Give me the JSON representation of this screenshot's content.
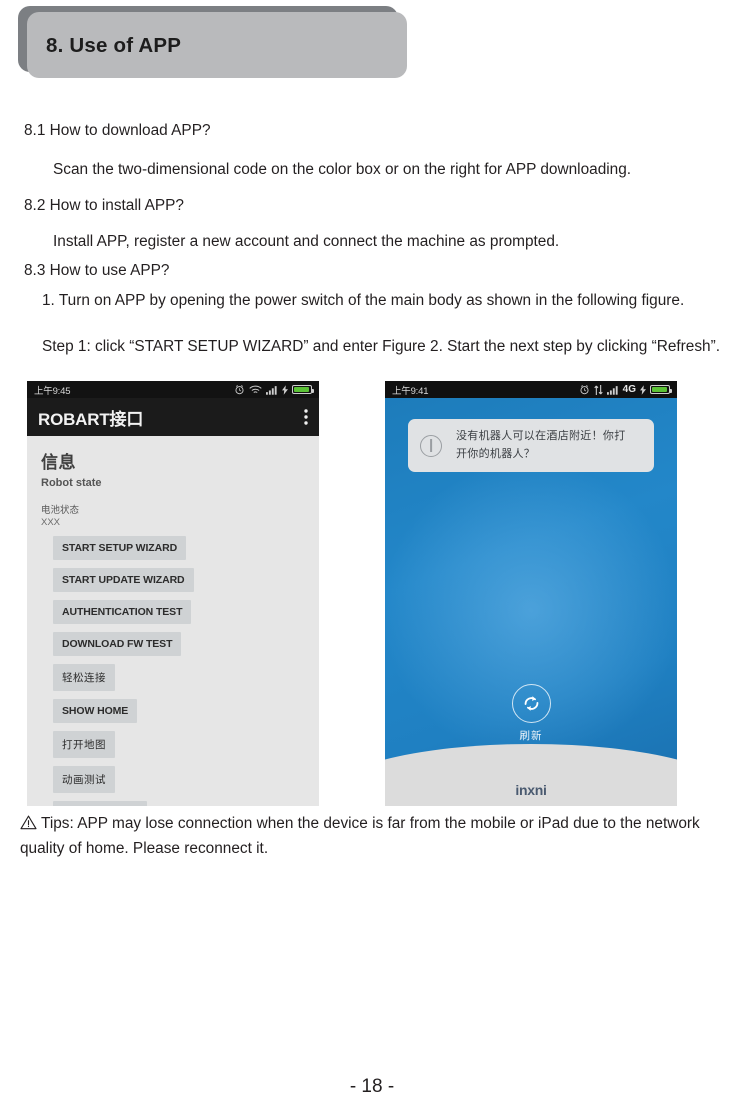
{
  "header": {
    "title": "8. Use of APP"
  },
  "content": {
    "q_download": "8.1 How to download APP?",
    "a_download": "Scan the two-dimensional code on the color box or on the right for APP downloading.",
    "q_install": "8.2 How to install APP?",
    "a_install": "Install APP, register a new account and connect the machine as prompted.",
    "q_use": "8.3 How to use APP?",
    "step_intro": "1. Turn on APP by opening the power switch of the main body as shown in the following figure.",
    "step_one": "Step 1: click “START SETUP WIZARD” and enter Figure 2. Start the next step by clicking “Refresh”."
  },
  "tips": {
    "icon": "warning-triangle-icon",
    "text": "Tips: APP may lose connection when the device is far from the mobile or iPad due to the network quality of home. Please reconnect it."
  },
  "page": {
    "number": "- 18 -"
  },
  "figure_left": {
    "status_bar": {
      "time": "上午9:45",
      "icons": [
        "alarm-clock-icon",
        "wifi-icon",
        "signal-bars-icon",
        "charging-bolt-icon",
        "battery-icon"
      ]
    },
    "app_bar": {
      "title": "ROBART接口",
      "overflow_icon": "more-vertical-icon"
    },
    "heading": "信息",
    "subheading": "Robot state",
    "battery_label": "电池状态",
    "battery_value": "XXX",
    "buttons": [
      "START SETUP WIZARD",
      "START UPDATE WIZARD",
      "AUTHENTICATION TEST",
      "DOWNLOAD FW TEST",
      "轻松连接",
      "SHOW HOME",
      "打开地图",
      "动画测试"
    ]
  },
  "figure_right": {
    "status_bar": {
      "time": "上午9:41",
      "network": "4G",
      "icons": [
        "alarm-clock-icon",
        "data-transfer-icon",
        "signal-bars-icon",
        "charging-bolt-icon",
        "battery-icon"
      ]
    },
    "dialog": {
      "icon": "info-icon",
      "line1": "没有机器人可以在酒店附近！你打",
      "line2": "开你的机器人？"
    },
    "refresh": {
      "icon": "refresh-icon",
      "label": "刷新"
    },
    "logo": "inxni"
  },
  "colors": {
    "header_plate": "#b9babc",
    "header_shadow": "#7c7f83",
    "app_blue": "#2387c9",
    "battery_green": "#5bc236"
  }
}
